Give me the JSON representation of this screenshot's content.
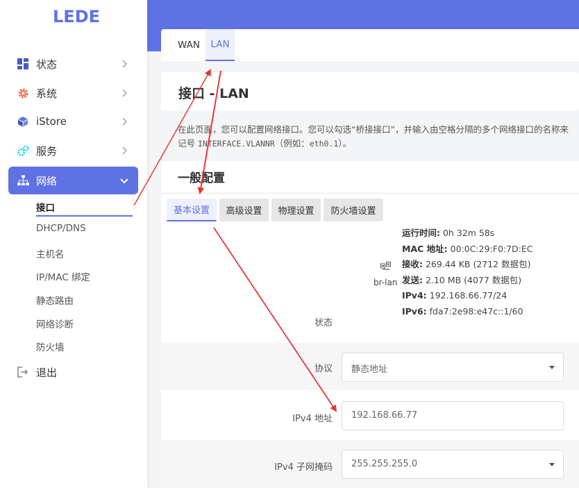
{
  "logo": "LEDE",
  "sidebar": {
    "items": [
      {
        "label": "状态",
        "icon": "dashboard-icon"
      },
      {
        "label": "系统",
        "icon": "gear-icon"
      },
      {
        "label": "iStore",
        "icon": "cube-icon"
      },
      {
        "label": "服务",
        "icon": "cogs-icon"
      },
      {
        "label": "网络",
        "icon": "network-icon"
      }
    ],
    "sub_items": [
      "接口",
      "DHCP/DNS",
      "主机名",
      "IP/MAC 绑定",
      "静态路由",
      "网络诊断",
      "防火墙"
    ],
    "logout": "退出"
  },
  "tabs": [
    "WAN",
    "LAN"
  ],
  "page_title": "接口 - LAN",
  "description": {
    "line1": "在此页面，您可以配置网络接口。您可以勾选“桥接接口”，并输入由空格分隔的多个网络接口的名称来",
    "line2_prefix": "记号 ",
    "line2_code": "INTERFACE.VLANNR",
    "line2_mid": "（例如：",
    "line2_example": "eth0.1",
    "line2_suffix": "）。"
  },
  "section_title": "一般配置",
  "subtabs": [
    "基本设置",
    "高级设置",
    "物理设置",
    "防火墙设置"
  ],
  "status": {
    "label": "状态",
    "device": "br-lan",
    "uptime_label": "运行时间:",
    "uptime": "0h 32m 58s",
    "mac_label": "MAC 地址:",
    "mac": "00:0C:29:F0:7D:EC",
    "rx_label": "接收:",
    "rx": "269.44 KB (2712 数据包)",
    "tx_label": "发送:",
    "tx": "2.10 MB (4077 数据包)",
    "ipv4_label": "IPv4:",
    "ipv4": "192.168.66.77/24",
    "ipv6_label": "IPv6:",
    "ipv6": "fda7:2e98:e47c::1/60"
  },
  "fields": {
    "protocol_label": "协议",
    "protocol_value": "静态地址",
    "ipv4_label": "IPv4 地址",
    "ipv4_placeholder": "192.168.66.77",
    "netmask_label": "IPv4 子网掩码",
    "netmask_value": "255.255.255.0"
  },
  "colors": {
    "accent": "#5e72e4",
    "orange": "#fb6340",
    "annotation_arrow": "#e53935"
  }
}
